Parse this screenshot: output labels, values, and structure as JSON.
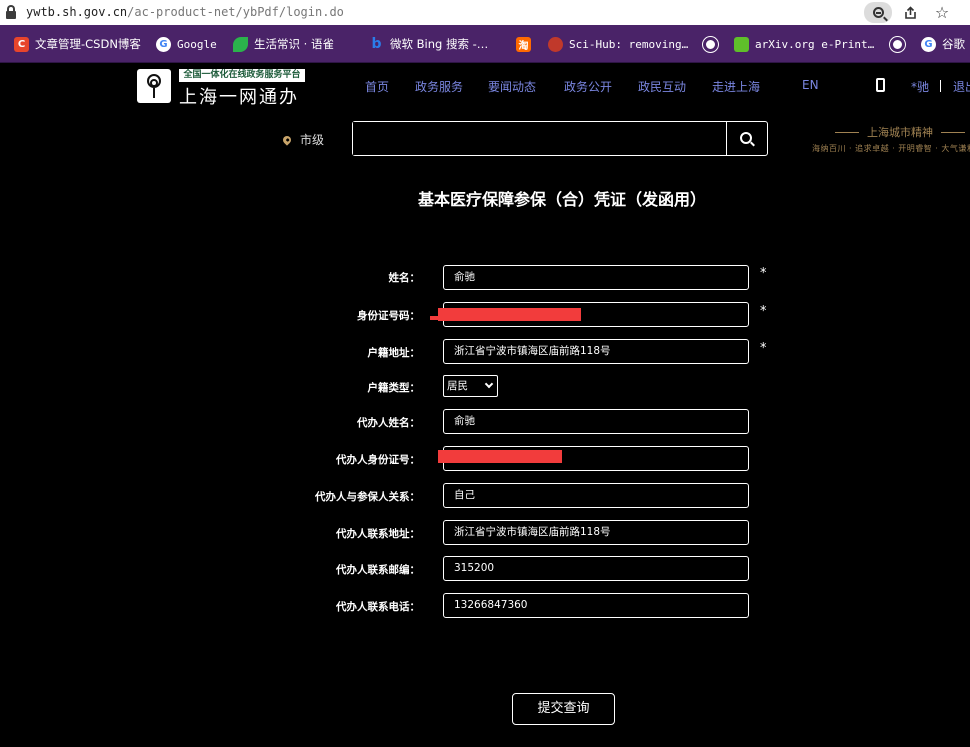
{
  "browser": {
    "url_host": "ywtb.sh.gov.cn",
    "url_path": "/ac-product-net/ybPdf/login.do"
  },
  "bookmarks": [
    {
      "label": "文章管理-CSDN博客",
      "icon": "csdn-icon",
      "icon_text": "C",
      "color": "#e8452c"
    },
    {
      "label": "Google",
      "icon": "google-icon",
      "icon_text": "G",
      "color": "#ffffff"
    },
    {
      "label": "生活常识 · 语雀",
      "icon": "yuque-icon",
      "icon_text": "",
      "color": "#2bb24c"
    },
    {
      "label": "微软 Bing 搜索 -…",
      "icon": "bing-icon",
      "icon_text": "b",
      "color": "#2b7de9"
    },
    {
      "label": "",
      "icon": "taobao-icon",
      "icon_text": "淘",
      "color": "#ff6a00"
    },
    {
      "label": "Sci-Hub: removing…",
      "icon": "scihub-icon",
      "icon_text": "",
      "color": "#c0392b"
    },
    {
      "label": "",
      "icon": "globe-icon",
      "icon_text": "",
      "color": "#ffffff"
    },
    {
      "label": "arXiv.org e-Print…",
      "icon": "arxiv-icon",
      "icon_text": "",
      "color": "#5fbf2a"
    },
    {
      "label": "",
      "icon": "globe-icon",
      "icon_text": "",
      "color": "#ffffff"
    },
    {
      "label": "谷歌",
      "icon": "google-icon",
      "icon_text": "G",
      "color": "#ffffff"
    }
  ],
  "header": {
    "logo_tagline": "全国一体化在线政务服务平台",
    "logo_name": "上海一网通办",
    "nav": [
      "首页",
      "政务服务",
      "要闻动态",
      "政务公开",
      "政民互动",
      "走进上海",
      "EN"
    ],
    "user": "*驰",
    "logout": "退出"
  },
  "search": {
    "location": "市级",
    "placeholder": ""
  },
  "spirit_banner": {
    "title": "上海城市精神",
    "subtitle": "海纳百川 · 追求卓越 · 开明睿智 · 大气谦和"
  },
  "form": {
    "title": "基本医疗保障参保（合）凭证（发函用）",
    "fields": {
      "name": {
        "label": "姓名：",
        "value": "俞驰",
        "required": "*"
      },
      "id_number": {
        "label": "身份证号码：",
        "value": "",
        "required": "*"
      },
      "household_address": {
        "label": "户籍地址：",
        "value": "浙江省宁波市镇海区庙前路118号",
        "required": "*"
      },
      "household_type": {
        "label": "户籍类型：",
        "value": "居民"
      },
      "agent_name": {
        "label": "代办人姓名：",
        "value": "俞驰"
      },
      "agent_id": {
        "label": "代办人身份证号：",
        "value": ""
      },
      "agent_relation": {
        "label": "代办人与参保人关系：",
        "value": "自己"
      },
      "agent_address": {
        "label": "代办人联系地址：",
        "value": "浙江省宁波市镇海区庙前路118号"
      },
      "agent_postcode": {
        "label": "代办人联系邮编：",
        "value": "315200"
      },
      "agent_phone": {
        "label": "代办人联系电话：",
        "value": "13266847360"
      }
    },
    "submit_label": "提交查询"
  },
  "colors": {
    "nav_link": "#7a86e0",
    "bookmark_bar": "#4a2368",
    "redaction": "#f23c3c",
    "accent_gold": "#a08252"
  }
}
